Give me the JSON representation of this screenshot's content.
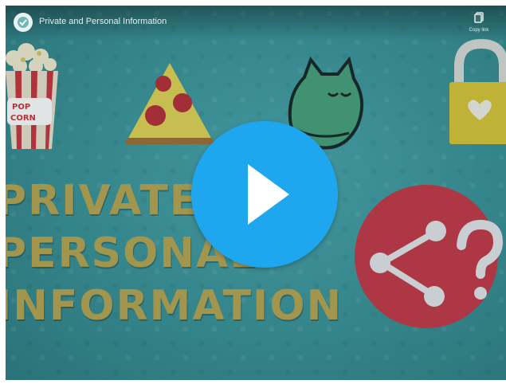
{
  "video": {
    "title": "Private and Personal Information",
    "copy_link_label": "Copy link"
  },
  "thumbnail": {
    "headline_lines": [
      "PRIVATE",
      "PERSONAL",
      "INFORMATION"
    ],
    "popcorn_text_lines": [
      "POP",
      "CORN"
    ]
  },
  "icons": {
    "channel_logo": "channel-logo-icon",
    "copy": "copy-icon",
    "play": "play-icon",
    "popcorn": "popcorn-icon",
    "pizza": "pizza-icon",
    "cat": "sleeping-cat-icon",
    "lock": "padlock-heart-icon",
    "share": "share-question-icon"
  },
  "colors": {
    "background": "#3b9398",
    "play_button": "#1ea7ee",
    "headline": "#b8a552",
    "share_circle": "#c43b48",
    "lock_body": "#d9c63a"
  }
}
